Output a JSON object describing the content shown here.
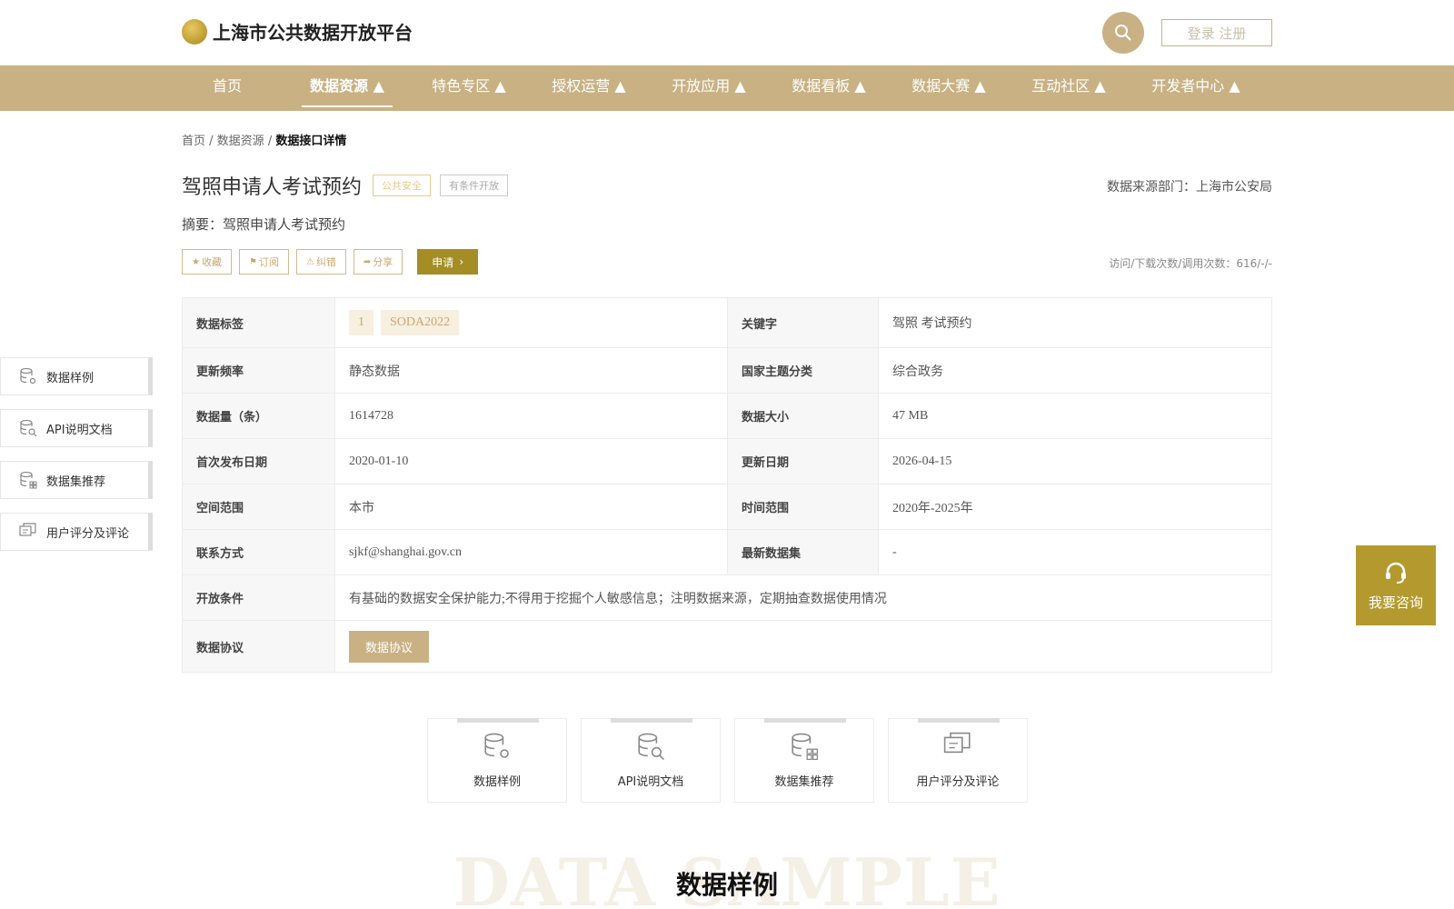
{
  "header": {
    "site_title": "上海市公共数据开放平台",
    "login_label": "登录 注册"
  },
  "nav": {
    "items": [
      {
        "label": "首页"
      },
      {
        "label": "数据资源 ▲"
      },
      {
        "label": "特色专区 ▲"
      },
      {
        "label": "授权运营 ▲"
      },
      {
        "label": "开放应用 ▲"
      },
      {
        "label": "数据看板 ▲"
      },
      {
        "label": "数据大赛 ▲"
      },
      {
        "label": "互动社区 ▲"
      },
      {
        "label": "开发者中心 ▲"
      }
    ],
    "active_index": 1
  },
  "breadcrumb": {
    "home": "首页",
    "sep": " / ",
    "section": "数据资源",
    "current": "数据接口详情"
  },
  "dataset": {
    "title": "驾照申请人考试预约",
    "tag_category": "公共安全",
    "tag_open": "有条件开放",
    "source_dept": "数据来源部门：上海市公安局",
    "summary": "摘要：驾照申请人考试预约",
    "stats": "访问/下载次数/调用次数：616/-/-"
  },
  "actions": {
    "favorite": "收藏",
    "subscribe": "订阅",
    "report": "纠错",
    "share": "分享",
    "apply": "申请"
  },
  "info": {
    "tags_label": "数据标签",
    "tags": [
      "1",
      "SODA2022"
    ],
    "keywords_label": "关键字",
    "keywords": "驾照 考试预约",
    "freq_label": "更新频率",
    "freq": "静态数据",
    "theme_label": "国家主题分类",
    "theme": "综合政务",
    "count_label": "数据量（条）",
    "count": "1614728",
    "size_label": "数据大小",
    "size": "47 MB",
    "publish_label": "首次发布日期",
    "publish": "2020-01-10",
    "updated_label": "更新日期",
    "updated": "2026-04-15",
    "space_label": "空间范围",
    "space": "本市",
    "time_label": "时间范围",
    "time": "2020年-2025年",
    "contact_label": "联系方式",
    "contact": "sjkf@shanghai.gov.cn",
    "latest_label": "最新数据集",
    "latest": "-",
    "conditions_label": "开放条件",
    "conditions": "有基础的数据安全保护能力;不得用于挖掘个人敏感信息；注明数据来源，定期抽查数据使用情况",
    "agreement_label": "数据协议",
    "agreement_btn": "数据协议"
  },
  "side_nav": [
    {
      "label": "数据样例",
      "icon": "database-gear-icon"
    },
    {
      "label": "API说明文档",
      "icon": "database-search-icon"
    },
    {
      "label": "数据集推荐",
      "icon": "database-grid-icon"
    },
    {
      "label": "用户评分及评论",
      "icon": "comment-icon"
    }
  ],
  "consult_label": "我要咨询",
  "cards": [
    {
      "label": "数据样例",
      "icon": "database-gear-icon"
    },
    {
      "label": "API说明文档",
      "icon": "database-search-icon"
    },
    {
      "label": "数据集推荐",
      "icon": "database-grid-icon"
    },
    {
      "label": "用户评分及评论",
      "icon": "comment-icon"
    }
  ],
  "section": {
    "bg_text": "DATA SAMPLE",
    "title": "数据样例"
  },
  "colors": {
    "brand": "#c9b183",
    "accent_dark": "#a48d25",
    "consult": "#b49a2e"
  }
}
